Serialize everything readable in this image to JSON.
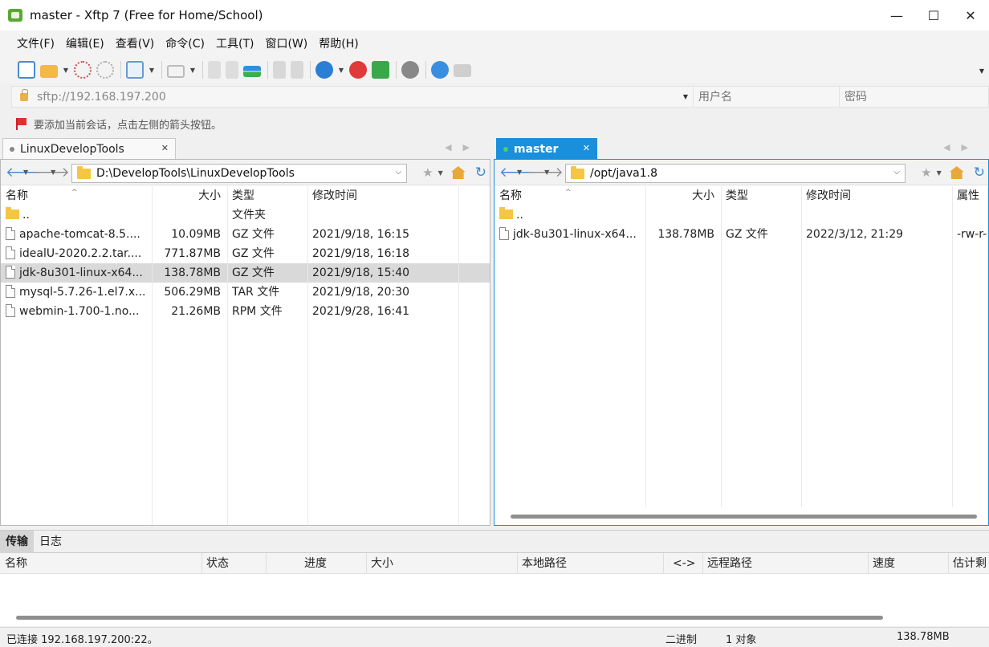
{
  "window": {
    "title": "master - Xftp 7 (Free for Home/School)",
    "minimize": "—",
    "maximize": "☐",
    "close": "✕"
  },
  "menu": [
    "文件(F)",
    "编辑(E)",
    "查看(V)",
    "命令(C)",
    "工具(T)",
    "窗口(W)",
    "帮助(H)"
  ],
  "address": {
    "host_value": "sftp://192.168.197.200",
    "user_placeholder": "用户名",
    "password_placeholder": "密码"
  },
  "hint": "要添加当前会话，点击左侧的箭头按钮。",
  "left_pane": {
    "tab": "LinuxDevelopTools",
    "path": "D:\\DevelopTools\\LinuxDevelopTools",
    "columns": [
      "名称",
      "大小",
      "类型",
      "修改时间"
    ],
    "rows": [
      {
        "name": "..",
        "size": "",
        "type": "文件夹",
        "modified": "",
        "icon": "folder-icon"
      },
      {
        "name": "apache-tomcat-8.5....",
        "size": "10.09MB",
        "type": "GZ 文件",
        "modified": "2021/9/18, 16:15",
        "icon": "file-icon"
      },
      {
        "name": "idealU-2020.2.2.tar....",
        "size": "771.87MB",
        "type": "GZ 文件",
        "modified": "2021/9/18, 16:18",
        "icon": "file-icon"
      },
      {
        "name": "jdk-8u301-linux-x64...",
        "size": "138.78MB",
        "type": "GZ 文件",
        "modified": "2021/9/18, 15:40",
        "icon": "file-icon",
        "selected": true
      },
      {
        "name": "mysql-5.7.26-1.el7.x...",
        "size": "506.29MB",
        "type": "TAR 文件",
        "modified": "2021/9/18, 20:30",
        "icon": "file-icon"
      },
      {
        "name": "webmin-1.700-1.no...",
        "size": "21.26MB",
        "type": "RPM 文件",
        "modified": "2021/9/28, 16:41",
        "icon": "file-icon"
      }
    ]
  },
  "right_pane": {
    "tab": "master",
    "path": "/opt/java1.8",
    "columns": [
      "名称",
      "大小",
      "类型",
      "修改时间",
      "属性"
    ],
    "rows": [
      {
        "name": "..",
        "size": "",
        "type": "",
        "modified": "",
        "attr": "",
        "icon": "folder-icon"
      },
      {
        "name": "jdk-8u301-linux-x64...",
        "size": "138.78MB",
        "type": "GZ 文件",
        "modified": "2022/3/12, 21:29",
        "attr": "-rw-r-",
        "icon": "file-icon"
      }
    ]
  },
  "transfer": {
    "tabs": [
      "传输",
      "日志"
    ],
    "columns": [
      "名称",
      "状态",
      "进度",
      "大小",
      "本地路径",
      "<->",
      "远程路径",
      "速度",
      "估计剩"
    ]
  },
  "status": {
    "connection": "已连接 192.168.197.200:22。",
    "mode": "二进制",
    "objects": "1 对象",
    "size": "138.78MB"
  },
  "colors": {
    "active_tab": "#1a8fdc",
    "selection": "#d9d9d9"
  }
}
